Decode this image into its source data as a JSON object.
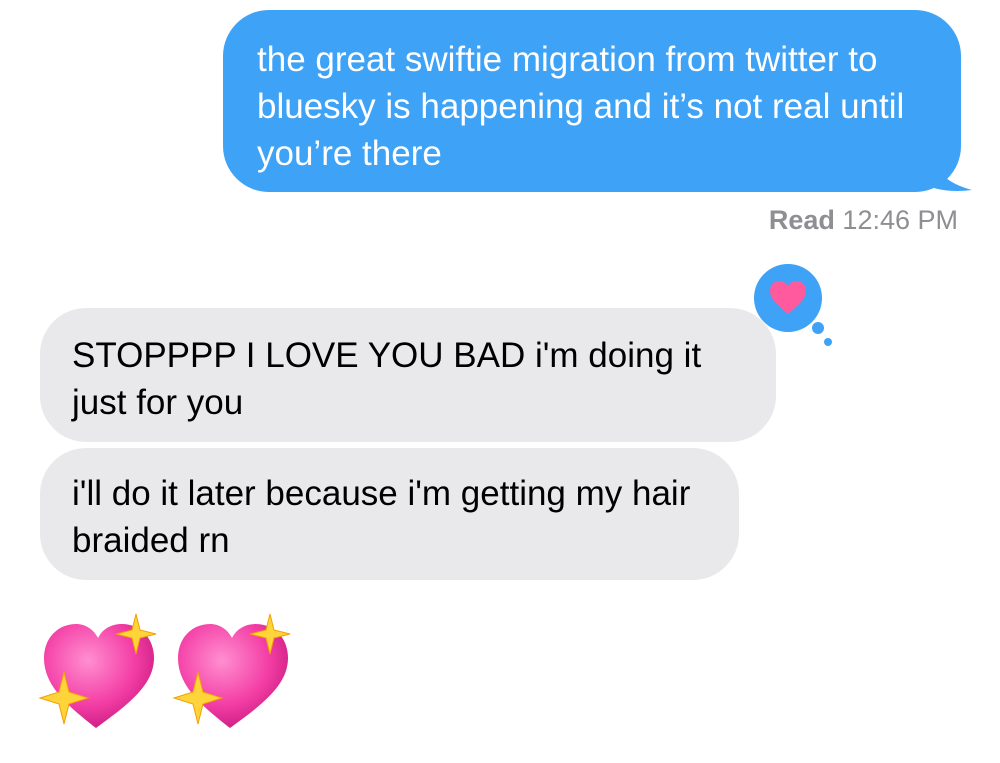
{
  "messages": [
    {
      "direction": "outgoing",
      "text": "the great swiftie migration from twitter to bluesky is happening and it’s not real until you’re there"
    },
    {
      "direction": "incoming",
      "text": "STOPPPP I LOVE YOU BAD i'm doing it just for you"
    },
    {
      "direction": "incoming",
      "text": "i'll do it later because i'm getting my hair braided rn"
    }
  ],
  "receipt": {
    "label": "Read",
    "time": "12:46 PM"
  },
  "tapback": {
    "icon": "heart-tapback-icon",
    "color": "#3ea2f7",
    "heart_color": "#ff5a9d"
  },
  "emoji_message": {
    "emojis": [
      "sparkling-heart-icon",
      "sparkling-heart-icon"
    ]
  },
  "colors": {
    "outgoing_bubble": "#3ea2f7",
    "incoming_bubble": "#e9e9eb",
    "receipt_text": "#8e8e93"
  }
}
